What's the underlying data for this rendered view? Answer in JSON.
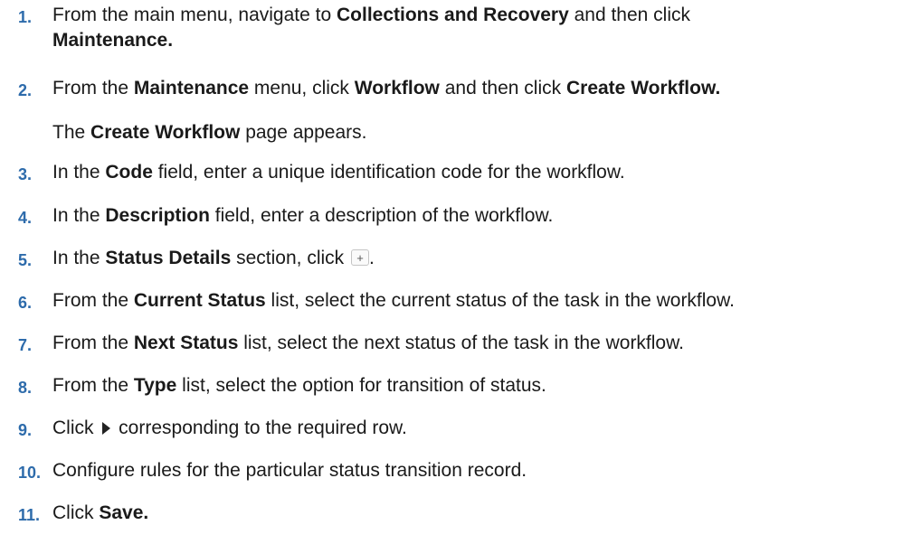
{
  "steps": [
    {
      "number": "1.",
      "parts": [
        {
          "t": "From the main menu, navigate to "
        },
        {
          "b": "Collections and Recovery"
        },
        {
          "t": " and then click "
        },
        {
          "b": "Maintenance."
        }
      ]
    },
    {
      "number": "2.",
      "parts": [
        {
          "t": "From the "
        },
        {
          "b": "Maintenance"
        },
        {
          "t": " menu, click "
        },
        {
          "b": "Workflow"
        },
        {
          "t": " and then click "
        },
        {
          "b": "Create Workflow."
        }
      ],
      "note": [
        {
          "t": "The "
        },
        {
          "b": "Create Workflow"
        },
        {
          "t": " page appears."
        }
      ]
    },
    {
      "number": "3.",
      "parts": [
        {
          "t": "In the "
        },
        {
          "b": "Code"
        },
        {
          "t": " field, enter a unique identification code for the workflow."
        }
      ]
    },
    {
      "number": "4.",
      "parts": [
        {
          "t": "In the "
        },
        {
          "b": "Description"
        },
        {
          "t": " field, enter a description of the workflow."
        }
      ]
    },
    {
      "number": "5.",
      "parts": [
        {
          "t": "In the "
        },
        {
          "b": "Status Details"
        },
        {
          "t": " section, click "
        },
        {
          "icon": "add-icon",
          "glyph": "+"
        },
        {
          "t": "."
        }
      ]
    },
    {
      "number": "6.",
      "parts": [
        {
          "t": "From the "
        },
        {
          "b": "Current Status"
        },
        {
          "t": " list, select the current status of the task in the workflow."
        }
      ]
    },
    {
      "number": "7.",
      "parts": [
        {
          "t": "From the "
        },
        {
          "b": "Next Status"
        },
        {
          "t": " list, select the next status of the task in the workflow."
        }
      ]
    },
    {
      "number": "8.",
      "parts": [
        {
          "t": "From the "
        },
        {
          "b": "Type"
        },
        {
          "t": " list, select the option for transition of status."
        }
      ]
    },
    {
      "number": "9.",
      "parts": [
        {
          "t": "Click "
        },
        {
          "icon": "expand-triangle-icon"
        },
        {
          "t": " corresponding to the required row."
        }
      ]
    },
    {
      "number": "10.",
      "parts": [
        {
          "t": "Configure rules for the particular status transition record."
        }
      ]
    },
    {
      "number": "11.",
      "parts": [
        {
          "t": "Click "
        },
        {
          "b": "Save."
        }
      ]
    }
  ],
  "colors": {
    "number": "#2d6bab",
    "text": "#1a1a1a"
  }
}
